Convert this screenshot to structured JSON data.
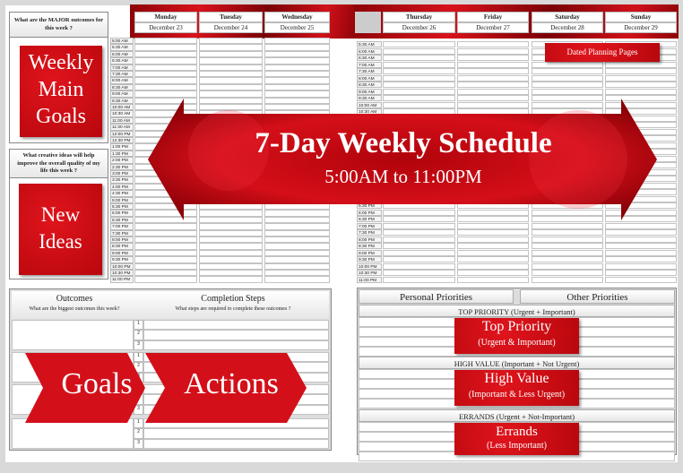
{
  "left_panel": {
    "major_question": "What are the MAJOR outcomes for this week ?",
    "weekly_goals_label": [
      "Weekly",
      "Main",
      "Goals"
    ],
    "ideas_question": "What creative ideas will help improve the overall quality of my life this week ?",
    "new_ideas_label": [
      "New",
      "Ideas"
    ]
  },
  "days": [
    {
      "name": "Monday",
      "date": "December 23"
    },
    {
      "name": "Tuesday",
      "date": "December 24"
    },
    {
      "name": "Wednesday",
      "date": "December 25"
    },
    {
      "name": "Thursday",
      "date": "December 26"
    },
    {
      "name": "Friday",
      "date": "December 27"
    },
    {
      "name": "Saturday",
      "date": "December 28"
    },
    {
      "name": "Sunday",
      "date": "December 29"
    }
  ],
  "times": [
    "5:00 AM",
    "5:30 AM",
    "6:00 AM",
    "6:30 AM",
    "7:00 AM",
    "7:30 AM",
    "8:00 AM",
    "8:30 AM",
    "9:00 AM",
    "9:30 AM",
    "10:00 AM",
    "10:30 AM",
    "11:00 AM",
    "11:30 AM",
    "12:00 PM",
    "12:30 PM",
    "1:00 PM",
    "1:30 PM",
    "2:00 PM",
    "2:30 PM",
    "3:00 PM",
    "3:30 PM",
    "4:00 PM",
    "4:30 PM",
    "5:00 PM",
    "5:30 PM",
    "6:00 PM",
    "6:30 PM",
    "7:00 PM",
    "7:30 PM",
    "8:00 PM",
    "8:30 PM",
    "9:00 PM",
    "9:30 PM",
    "10:00 PM",
    "10:30 PM",
    "11:00 PM"
  ],
  "badge": "Dated Planning Pages",
  "banner": {
    "title": "7-Day Weekly Schedule",
    "subtitle": "5:00AM to 11:00PM"
  },
  "outcomes": {
    "title": "Outcomes",
    "subtitle": "What are the biggest outcomes this week?",
    "steps_title": "Completion Steps",
    "steps_subtitle": "What steps are required to complete these outcomes ?",
    "step_numbers": [
      "1",
      "2",
      "3"
    ],
    "goals_label": "Goals",
    "actions_label": "Actions"
  },
  "priorities": {
    "personal": "Personal Priorities",
    "other": "Other Priorities",
    "sections": [
      {
        "heading": "TOP PRIORITY (Urgent + Important)",
        "title": "Top Priority",
        "sub": "(Urgent & Important)"
      },
      {
        "heading": "HIGH VALUE (Important + Not Urgent)",
        "title": "High Value",
        "sub": "(Important & Less Urgent)"
      },
      {
        "heading": "ERRANDS (Urgent + Not-Important)",
        "title": "Errands",
        "sub": "(Less Important)"
      }
    ]
  },
  "colors": {
    "accent": "#d0101a",
    "dark_red": "#8d0208",
    "panel_border": "#888888"
  }
}
